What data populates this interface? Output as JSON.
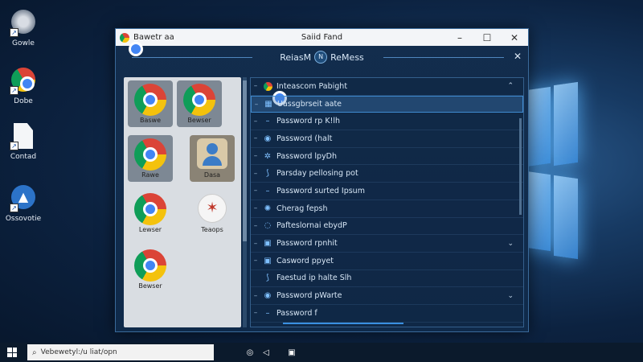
{
  "desktop": {
    "icons": [
      {
        "label": "Gowle",
        "icon": "chrome-icon"
      },
      {
        "label": "Dobe",
        "icon": "chrome-icon"
      },
      {
        "label": "Contad",
        "icon": "document-icon"
      },
      {
        "label": "Ossovotie",
        "icon": "app-icon"
      }
    ]
  },
  "window": {
    "app_name": "Bawetr aa",
    "title": "Saiid Fand",
    "controls": {
      "minimize": "–",
      "maximize": "☐",
      "close": "✕"
    },
    "header": {
      "left": "ReiasM",
      "badge": "N",
      "right": "ReMess",
      "close": "✕"
    }
  },
  "tiles": [
    {
      "label": "Baswe",
      "icon": "chrome-icon"
    },
    {
      "label": "Bewser",
      "icon": "chrome-icon"
    },
    {
      "label": "Rawe",
      "icon": "chrome-icon"
    },
    {
      "label": "Dasa",
      "icon": "user-icon"
    },
    {
      "label": "Lewser",
      "icon": "chrome-icon"
    },
    {
      "label": "Teaops",
      "icon": "network-icon"
    },
    {
      "label": "Bewser",
      "icon": "chrome-icon"
    }
  ],
  "list": {
    "rows": [
      {
        "label": "Inteascom Pabight",
        "icon": "chrome-icon",
        "chevron": "^"
      },
      {
        "label": "Uassgbrseit aate",
        "icon": "windows-icon",
        "selected": true
      },
      {
        "label": "Password rp K!lh",
        "icon": "dash-icon"
      },
      {
        "label": "Password (halt",
        "icon": "shield-icon"
      },
      {
        "label": "Password lpyDh",
        "icon": "gear-icon"
      },
      {
        "label": "Parsday pellosing pot",
        "icon": "hook-icon"
      },
      {
        "label": "Password surted Ipsum",
        "icon": "dash-icon"
      },
      {
        "label": "Cherag fepsh",
        "icon": "settings-icon"
      },
      {
        "label": "Pafteslornai ebydP",
        "icon": "globe-icon"
      },
      {
        "label": "Password rpnhit",
        "icon": "box-icon",
        "chevron": "v"
      },
      {
        "label": "Casword ppyet",
        "icon": "box-icon"
      },
      {
        "label": "Faestud ip halte Slh",
        "icon": "hook-icon"
      },
      {
        "label": "Password pWarte",
        "icon": "shield-icon",
        "chevron": "v"
      },
      {
        "label": "Password f",
        "icon": "dash-icon"
      }
    ]
  },
  "taskbar": {
    "search_text": "Vebewetyl:/u liat/opn"
  }
}
